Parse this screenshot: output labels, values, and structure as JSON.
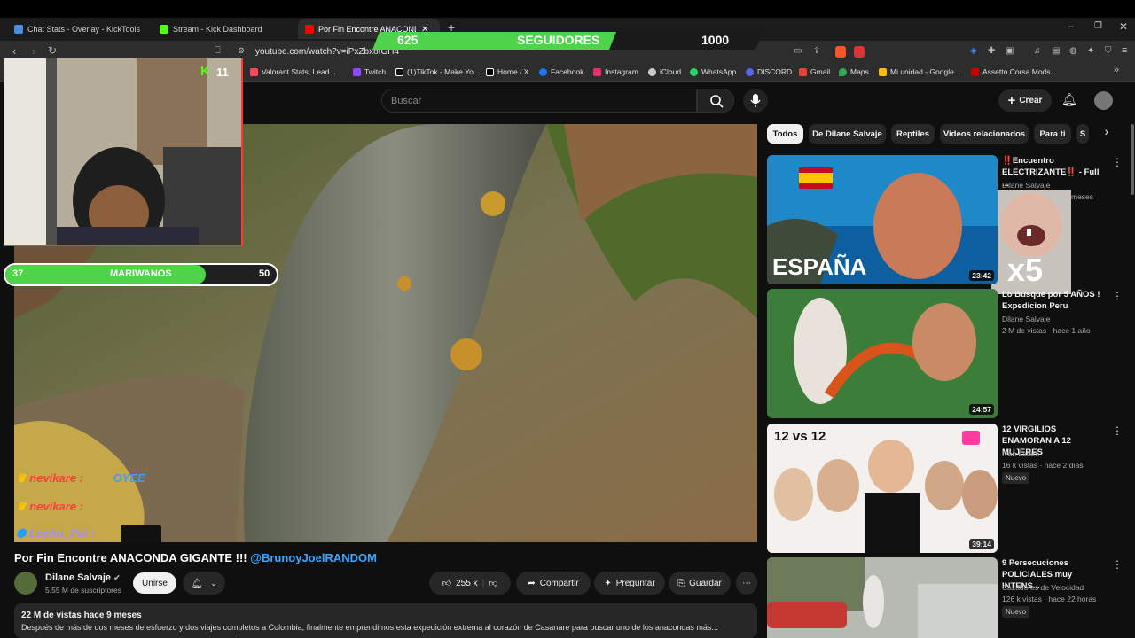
{
  "browser": {
    "tabs": [
      {
        "label": "Chat Stats - Overlay - KickTools",
        "color": "#4a90d9"
      },
      {
        "label": "Stream - Kick Dashboard",
        "color": "#53fc18"
      },
      {
        "label": "Por Fin Encontre ANACONDA",
        "color": "#ff0000"
      }
    ],
    "url": "youtube.com/watch?v=iPxZbxofGH4",
    "bookmarks": [
      {
        "label": "Valorant Stats, Lead...",
        "color": "#ff4655"
      },
      {
        "label": "Twitch",
        "color": "#9146ff"
      },
      {
        "label": "(1)TikTok - Make Yo...",
        "color": "#ffffff"
      },
      {
        "label": "Home / X",
        "color": "#ffffff"
      },
      {
        "label": "Facebook",
        "color": "#1877f2"
      },
      {
        "label": "Instagram",
        "color": "#e1306c"
      },
      {
        "label": "iCloud",
        "color": "#cccccc"
      },
      {
        "label": "WhatsApp",
        "color": "#25d366"
      },
      {
        "label": "DISCORD",
        "color": "#5865f2"
      },
      {
        "label": "Gmail",
        "color": "#ea4335"
      },
      {
        "label": "Maps",
        "color": "#34a853"
      },
      {
        "label": "Mi unidad - Google...",
        "color": "#fbbc04"
      },
      {
        "label": "Assetto Corsa Mods...",
        "color": "#cc0000"
      }
    ]
  },
  "overlay": {
    "followers_current": "625",
    "followers_label": "SEGUIDORES",
    "followers_goal": "1000",
    "followers_progress": 0.625,
    "kick_count": "11",
    "mariwanos_current": "37",
    "mariwanos_label": "MARIWANOS",
    "mariwanos_goal": "50",
    "mariwanos_progress": 0.74,
    "chat": [
      {
        "user": "nevikare",
        "msg": "OYEE"
      },
      {
        "user": "nevikare",
        "msg": ""
      },
      {
        "user": "Lochu_Pai",
        "msg": ""
      }
    ],
    "meme_text": "x5"
  },
  "yt": {
    "search_placeholder": "Buscar",
    "create_label": "Crear",
    "video_title": "Por Fin Encontre ANACONDA GIGANTE !!!",
    "video_mention": "@BrunoyJoelRANDOM",
    "channel_name": "Dilane Salvaje",
    "subscribers": "5.55 M de suscriptores",
    "join_label": "Unirse",
    "likes": "255 k",
    "share_label": "Compartir",
    "ask_label": "Preguntar",
    "save_label": "Guardar",
    "views_line": "22 M de vistas  hace 9 meses",
    "description": "Después de más de dos meses de esfuerzo y dos viajes completos a Colombia, finalmente emprendimos esta expedición extrema al corazón de Casanare para buscar uno de los anacondas más..."
  },
  "chips": [
    "Todos",
    "De Dilane Salvaje",
    "Reptiles",
    "Videos relacionados",
    "Para ti",
    "S"
  ],
  "related": [
    {
      "title": "‼️Encuentro ELECTRIZANTE‼️ - Full ...",
      "channel": "Dilane Salvaje",
      "meta": "meses",
      "duration": "23:42",
      "thumb_text": "ESPAÑA",
      "badge": ""
    },
    {
      "title": "Lo Busque por 5 AÑOS ! Expedicion Peru",
      "channel": "Dilane Salvaje",
      "meta": "2 M de vistas · hace 1 año",
      "duration": "24:57",
      "thumb_text": "",
      "badge": ""
    },
    {
      "title": "12 VIRGILIOS ENAMORAN A 12 MUJERES",
      "channel": "Iván Latam",
      "meta": "16 k vistas · hace 2 días",
      "duration": "39:14",
      "thumb_text": "12 vs 12",
      "badge": "Nuevo"
    },
    {
      "title": "9 Persecuciones POLICIALES muy INTENS...",
      "channel": "Cazadores de Velocidad",
      "meta": "126 k vistas · hace 22 horas",
      "duration": "",
      "thumb_text": "",
      "badge": "Nuevo"
    }
  ],
  "colors": {
    "accent": "#3ea6ff",
    "kick_green": "#53fc18",
    "bar_green": "#4ed34a"
  }
}
